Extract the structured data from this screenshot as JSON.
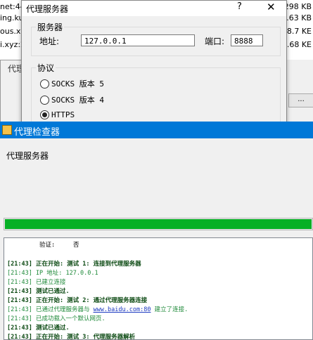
{
  "background": {
    "rows": [
      {
        "left": "net:44",
        "right": "298 KB"
      },
      {
        "left": "ing.ku",
        "right": "1.63 KB"
      },
      {
        "left": "ous.xyz",
        "right": "18.7 KE"
      },
      {
        "left": "i.xyz:2",
        "right": "2.68 KE"
      }
    ],
    "peek_title": "代理",
    "peek_button": "..."
  },
  "proxy_dialog": {
    "title": "代理服务器",
    "help": "?",
    "close": "✕",
    "server_group": "服务器",
    "address_label": "地址:",
    "address_value": "127.0.0.1",
    "port_label": "端口:",
    "port_value": "8888",
    "protocol_group": "协议",
    "protocols": [
      {
        "label": "SOCKS 版本 5",
        "selected": false
      },
      {
        "label": "SOCKS 版本 4",
        "selected": false
      },
      {
        "label": "HTTPS",
        "selected": true
      }
    ]
  },
  "checker": {
    "title": "代理检查器",
    "label": "代理服务器",
    "progress": 1.0,
    "log": {
      "verify_label": "验证:",
      "verify_value": "否",
      "lines": [
        {
          "text": "[21:43] 正在开始: 测试 1: 连接到代理服务器",
          "style": "dk"
        },
        {
          "text": "[21:43] IP 地址: 127.0.0.1",
          "style": "gr"
        },
        {
          "text": "[21:43] 已建立连接",
          "style": "gr"
        },
        {
          "text": "[21:43] 测试已通过.",
          "style": "dk"
        },
        {
          "text": "[21:43] 正在开始: 测试 2: 通过代理服务器连接",
          "style": "dk"
        },
        {
          "text_before": "[21:43] 已通过代理服务器与 ",
          "link": "www.baidu.com:80",
          "text_after": " 建立了连接.",
          "style": "gr"
        },
        {
          "text": "[21:43] 已成功载入一个默认网页.",
          "style": "gr"
        },
        {
          "text": "[21:43] 测试已通过.",
          "style": "dk"
        },
        {
          "text": "[21:43] 正在开始: 测试 3: 代理服务器解析",
          "style": "dk"
        }
      ]
    }
  }
}
